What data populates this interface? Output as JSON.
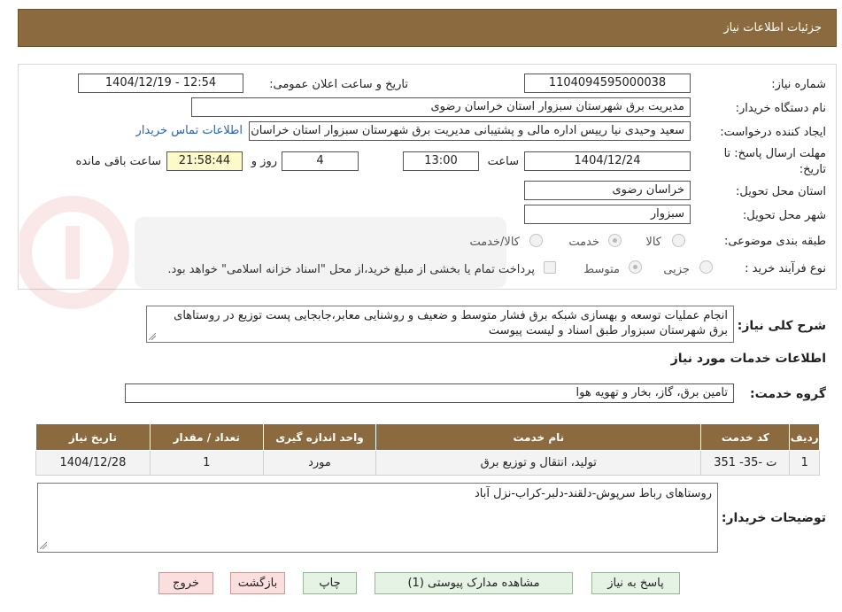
{
  "header": {
    "title": "جزئیات اطلاعات نیاز"
  },
  "form": {
    "need_number_label": "شماره نیاز:",
    "need_number": "1104094595000038",
    "announce_label": "تاریخ و ساعت اعلان عمومی:",
    "announce_value": "1404/12/19 - 12:54",
    "buyer_org_label": "نام دستگاه خریدار:",
    "buyer_org": "مدیریت برق شهرستان سبزوار استان خراسان رضوی",
    "requester_label": "ایجاد کننده درخواست:",
    "requester": "سعید وحیدی نیا رییس اداره مالی و پشتیبانی مدیریت برق شهرستان سبزوار استان خراسان رضوی",
    "contact_link": "اطلاعات تماس خریدار",
    "deadline_label_1": "مهلت ارسال پاسخ: تا",
    "deadline_label_2": "تاریخ:",
    "deadline_date": "1404/12/24",
    "time_label": "ساعت",
    "deadline_time": "13:00",
    "days_value": "4",
    "days_label": "روز و",
    "remaining_time": "21:58:44",
    "remaining_label": "ساعت باقی مانده",
    "province_label": "استان محل تحویل:",
    "province": "خراسان رضوی",
    "city_label": "شهر محل تحویل:",
    "city": "سبزوار",
    "category_label": "طبقه بندی موضوعی:",
    "category_options": [
      "کالا",
      "خدمت",
      "کالا/خدمت"
    ],
    "process_label": "نوع فرآیند خرید :",
    "process_options": [
      "جزیی",
      "متوسط"
    ],
    "payment_note": "پرداخت تمام یا بخشی از مبلغ خرید،از محل \"اسناد خزانه اسلامی\" خواهد بود."
  },
  "description": {
    "label": "شرح کلی نیاز:",
    "text": "انجام عملیات توسعه و بهسازی شبکه برق فشار متوسط و ضعیف و روشنایی معابر،جابجایی پست توزیع در روستاهای برق شهرستان سبزوار طبق اسناد و لیست پیوست"
  },
  "services": {
    "section_title": "اطلاعات خدمات مورد نیاز",
    "group_label": "گروه خدمت:",
    "group_value": "تامین برق، گاز، بخار و تهویه هوا",
    "table": {
      "headers": [
        "ردیف",
        "کد خدمت",
        "نام خدمت",
        "واحد اندازه گیری",
        "تعداد / مقدار",
        "تاریخ نیاز"
      ],
      "rows": [
        [
          "1",
          "ت -35- 351",
          "تولید، انتقال و توزیع برق",
          "مورد",
          "1",
          "1404/12/28"
        ]
      ]
    }
  },
  "notes": {
    "label": "توضیحات خریدار:",
    "text": "روستاهای رباط سرپوش-دلقند-دلبر-کراب-نزل آباد"
  },
  "buttons": {
    "reply": "پاسخ به نیاز",
    "attachments": "مشاهده مدارک پیوستی (1)",
    "print": "چاپ",
    "back": "بازگشت",
    "exit": "خروج"
  },
  "colors": {
    "header_bg": "#8a6a3e",
    "link": "#2a5fb8",
    "button_bg": "#e5f3e5",
    "danger_button_bg": "#fbdede",
    "timer_bg": "#fdfac9"
  }
}
